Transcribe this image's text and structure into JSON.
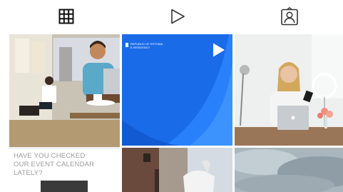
{
  "profile_tabs": [
    {
      "name": "grid",
      "icon": "grid-icon"
    },
    {
      "name": "reels",
      "icon": "play-icon"
    },
    {
      "name": "tagged",
      "icon": "tagged-person-icon"
    }
  ],
  "posts": {
    "post_1": {
      "caption": [
        "HAVE YOU CHECKED",
        "OUR EVENT CALENDAR",
        "LATELY?"
      ]
    },
    "post_2": {
      "badge": [
        "REPUBLIC OF ESTONIA",
        "E-RESIDENCY"
      ],
      "type_icon": "reel-play-icon"
    }
  },
  "colors": {
    "accent_blue": "#1a6be8",
    "icon": "#222222"
  }
}
